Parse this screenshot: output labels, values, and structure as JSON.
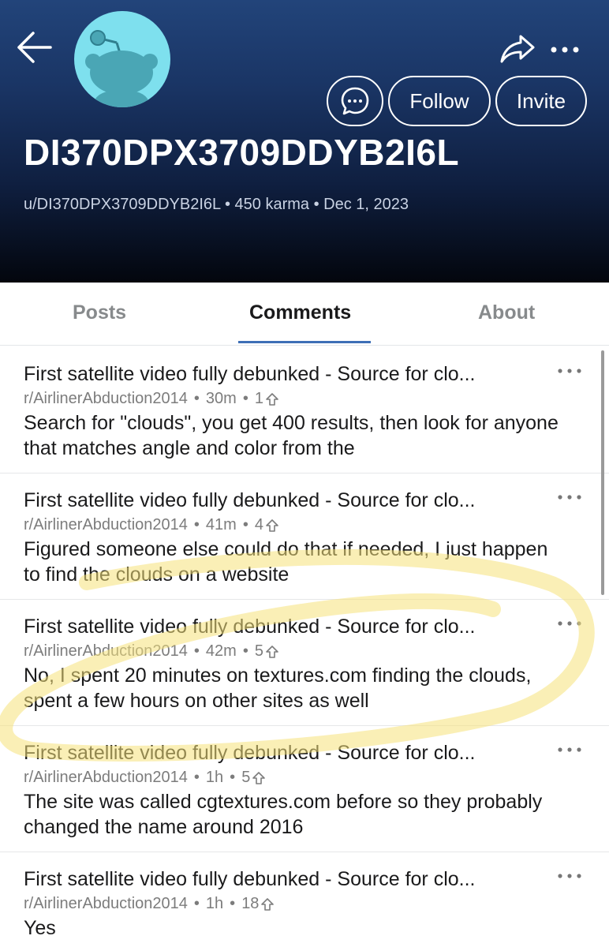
{
  "profile": {
    "display_name": "DI370DPX3709DDYB2I6L",
    "meta_line": "u/DI370DPX3709DDYB2I6L • 450 karma • Dec 1, 2023"
  },
  "header_actions": {
    "chat_icon": "chat-bubble-icon",
    "follow_label": "Follow",
    "invite_label": "Invite",
    "share_icon": "share-icon",
    "more_icon": "more-horizontal-icon",
    "back_icon": "back-arrow-icon"
  },
  "tabs": [
    {
      "label": "Posts",
      "active": false
    },
    {
      "label": "Comments",
      "active": true
    },
    {
      "label": "About",
      "active": false
    }
  ],
  "comments": [
    {
      "title": "First satellite video fully debunked - Source for clo...",
      "subreddit": "r/AirlinerAbduction2014",
      "age": "30m",
      "score": "1",
      "body": "Search for \"clouds\", you get 400 results, then look for anyone that matches angle and color from the"
    },
    {
      "title": "First satellite video fully debunked - Source for clo...",
      "subreddit": "r/AirlinerAbduction2014",
      "age": "41m",
      "score": "4",
      "body": "Figured someone else could do that if needed, I just happen to find the clouds on a website"
    },
    {
      "title": "First satellite video fully debunked - Source for clo...",
      "subreddit": "r/AirlinerAbduction2014",
      "age": "42m",
      "score": "5",
      "body": "No, I spent 20 minutes on textures.com finding the clouds, spent a few hours on other sites as well"
    },
    {
      "title": "First satellite video fully debunked - Source for clo...",
      "subreddit": "r/AirlinerAbduction2014",
      "age": "1h",
      "score": "5",
      "body": "The site was called cgtextures.com before so they probably changed the name around 2016"
    },
    {
      "title": "First satellite video fully debunked - Source for clo...",
      "subreddit": "r/AirlinerAbduction2014",
      "age": "1h",
      "score": "18",
      "body": "Yes"
    }
  ],
  "colors": {
    "tab_active_underline": "#3d6fb6",
    "highlight_marker": "#f6e27a",
    "avatar_bg": "#7ee0ee"
  }
}
